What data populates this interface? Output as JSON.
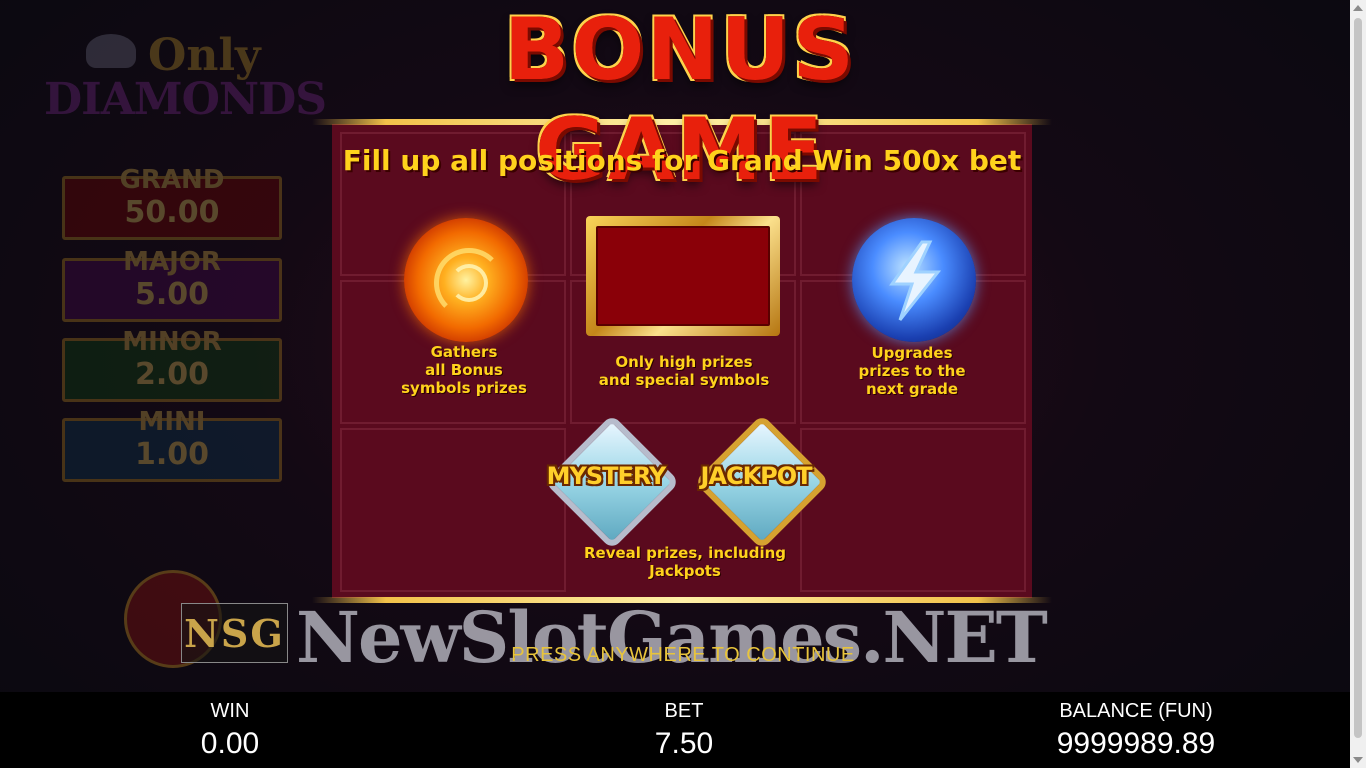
{
  "title": "BONUS GAME",
  "subtitle": "Fill up all positions for Grand Win 500x bet",
  "logo": {
    "line1": "Only",
    "line2": "DIAMONDS"
  },
  "jackpots": [
    {
      "name": "GRAND",
      "value": "50.00"
    },
    {
      "name": "MAJOR",
      "value": "5.00"
    },
    {
      "name": "MINOR",
      "value": "2.00"
    },
    {
      "name": "MINI",
      "value": "1.00"
    }
  ],
  "features": {
    "gather": "Gathers\nall Bonus\nsymbols prizes",
    "high": "Only high prizes\nand special symbols",
    "upgrade": "Upgrades\nprizes to the\nnext grade",
    "mystery": "MYSTERY",
    "jackpot": "JACKPOT",
    "reveal": "Reveal prizes, including\nJackpots"
  },
  "watermark": "NewSlotGames.NET",
  "watermark_badge": "NSG",
  "press": "PRESS ANYWHERE TO CONTINUE",
  "stats": {
    "win_label": "WIN",
    "win_value": "0.00",
    "bet_label": "BET",
    "bet_value": "7.50",
    "balance_label": "BALANCE (FUN)",
    "balance_value": "9999989.89"
  },
  "colors": {
    "accent": "#ffd21c",
    "panel": "#5a0a1e",
    "title": "#e8200c"
  },
  "icons": [
    "fire-orb-icon",
    "lightning-orb-icon",
    "gold-frame-icon",
    "mystery-gem-icon",
    "jackpot-gem-icon",
    "basket-icon"
  ]
}
